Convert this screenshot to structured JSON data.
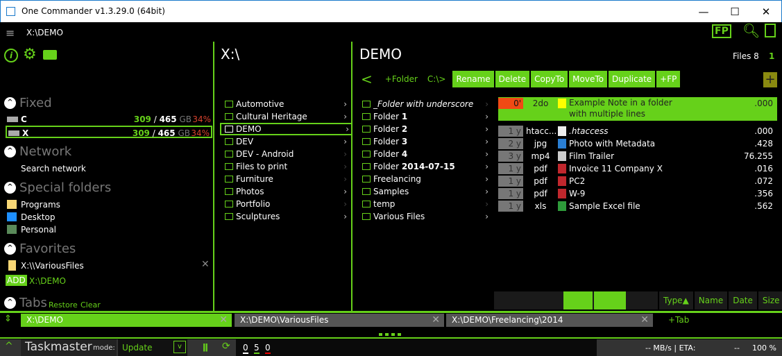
{
  "window": {
    "title": "One Commander v1.3.29.0 (64bit)",
    "minimize": "—",
    "maximize": "☐",
    "close": "✕"
  },
  "topbar": {
    "path": "X:\\DEMO",
    "fp_label": "FP"
  },
  "sidebar": {
    "fixed_header": "Fixed",
    "drives": [
      {
        "letter": "C",
        "used": "309",
        "total": "465",
        "unit": "GB",
        "pct": "34%"
      },
      {
        "letter": "X",
        "used": "309",
        "total": "465",
        "unit": "GB",
        "pct": "34%"
      }
    ],
    "network_header": "Network",
    "search_network": "Search network",
    "special_header": "Special folders",
    "special": [
      "Programs",
      "Desktop",
      "Personal"
    ],
    "favorites_header": "Favorites",
    "favorites": [
      "X:\\\\VariousFiles"
    ],
    "add_label": "ADD",
    "add_path": "X:\\DEMO",
    "tabs_header": "Tabs",
    "restore": "Restore",
    "clear": "Clear"
  },
  "col1": {
    "title": "X:\\",
    "items": [
      {
        "name": "Automotive",
        "sub": true
      },
      {
        "name": "Cultural Heritage",
        "sub": true
      },
      {
        "name": "DEMO",
        "sub": true
      },
      {
        "name": "DEV",
        "sub": true
      },
      {
        "name": "DEV - Android",
        "sub": false
      },
      {
        "name": "Files to print",
        "sub": false
      },
      {
        "name": "Furniture",
        "sub": false
      },
      {
        "name": "Photos",
        "sub": true
      },
      {
        "name": "Portfolio",
        "sub": false
      },
      {
        "name": "Sculptures",
        "sub": true
      }
    ]
  },
  "col2": {
    "items": [
      {
        "name": "_Folder with underscore",
        "bold": "",
        "sub": false,
        "italic": true
      },
      {
        "name": "Folder ",
        "bold": "1",
        "sub": true
      },
      {
        "name": "Folder ",
        "bold": "2",
        "sub": true
      },
      {
        "name": "Folder ",
        "bold": "3",
        "sub": true
      },
      {
        "name": "Folder ",
        "bold": "4",
        "sub": true
      },
      {
        "name": "Folder ",
        "bold": "2014-07-15",
        "sub": true
      },
      {
        "name": "Freelancing",
        "bold": "",
        "sub": true
      },
      {
        "name": "Samples",
        "bold": "",
        "sub": true
      },
      {
        "name": "temp",
        "bold": "",
        "sub": false
      },
      {
        "name": "Various Files",
        "bold": "",
        "sub": true
      }
    ]
  },
  "main": {
    "title": "DEMO",
    "files_label": "Files 8",
    "selected_count": "1",
    "toolbar": {
      "back": "<",
      "new_folder": "+Folder",
      "cmd": "C:\\>",
      "buttons": [
        "Rename",
        "Delete",
        "CopyTo",
        "MoveTo",
        "Duplicate",
        "+FP"
      ],
      "add": "+"
    },
    "files": [
      {
        "age": "0'",
        "ext": "2do",
        "icon": "note",
        "name": "Example Note in a folder",
        "name2": "with multiple lines",
        "size": ".000"
      },
      {
        "age": "1 y",
        "ext": "htacc...",
        "icon": "file",
        "name": ".htaccess",
        "size": ".000"
      },
      {
        "age": "2 y",
        "ext": "jpg",
        "icon": "image",
        "name": "Photo with Metadata",
        "size": ".428"
      },
      {
        "age": "3 y",
        "ext": "mp4",
        "icon": "video",
        "name": "Film Trailer",
        "size": "76.255"
      },
      {
        "age": "1 y",
        "ext": "pdf",
        "icon": "pdf",
        "name": "Invoice 11 Company X",
        "size": ".016"
      },
      {
        "age": "1 y",
        "ext": "pdf",
        "icon": "pdf",
        "name": "PC2",
        "size": ".072"
      },
      {
        "age": "1 y",
        "ext": "pdf",
        "icon": "pdf",
        "name": "W-9",
        "size": ".356"
      },
      {
        "age": "1 y",
        "ext": "xls",
        "icon": "excel",
        "name": "Sample Excel file",
        "size": ".562"
      }
    ],
    "sort": [
      "Type▲",
      "Name",
      "Date",
      "Size"
    ]
  },
  "tabs": {
    "items": [
      "X:\\DEMO",
      "X:\\DEMO\\VariousFiles",
      "X:\\DEMO\\Freelancing\\2014"
    ],
    "add": "+Tab"
  },
  "taskmaster": {
    "title": "Taskmaster",
    "mode_label": "mode:",
    "mode": "Update",
    "counts": [
      "0",
      "5",
      "0"
    ],
    "speed": "-- MB/s | ETA:",
    "eta": "--",
    "pct": "100 %"
  },
  "colors": {
    "accent": "#66d11a",
    "danger": "#d9422e",
    "note": "#ffff00"
  }
}
